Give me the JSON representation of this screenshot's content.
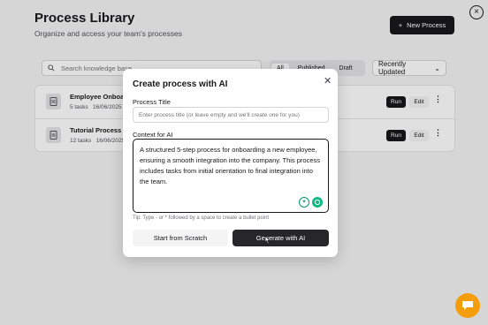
{
  "header": {
    "title": "Process Library",
    "subtitle": "Organize and access your team's processes",
    "new_button_label": "New Process",
    "new_button_icon": "plus-icon",
    "close_icon": "close-icon"
  },
  "toolbar": {
    "search_placeholder": "Search knowledge base",
    "filters": [
      "All",
      "Published",
      "Draft"
    ],
    "active_filter": "All",
    "sort_label": "Recently Updated"
  },
  "processes": [
    {
      "name": "Employee Onboarding",
      "tasks": "5 tasks",
      "date": "16/06/2025",
      "run_label": "Run",
      "edit_label": "Edit"
    },
    {
      "name": "Tutorial Process",
      "tasks": "12 tasks",
      "date": "16/06/2025",
      "run_label": "Run",
      "edit_label": "Edit"
    }
  ],
  "modal": {
    "title": "Create process with AI",
    "title_label": "Process Title",
    "title_placeholder": "Enter process title (or leave empty and we'll create one for you)",
    "context_label": "Context for AI",
    "context_text": "A structured 5-step process for onboarding a new employee, ensuring a smooth integration into the company. This process includes tasks from initial orientation to final integration into the team.",
    "tip": "Tip: Type - or * followed by a space to create a bullet point",
    "secondary_button": "Start from Scratch",
    "primary_button": "Generate with AI"
  },
  "colors": {
    "primary": "#18181b",
    "accent_green": "#10b981",
    "chat_bubble": "#f59e0b"
  }
}
